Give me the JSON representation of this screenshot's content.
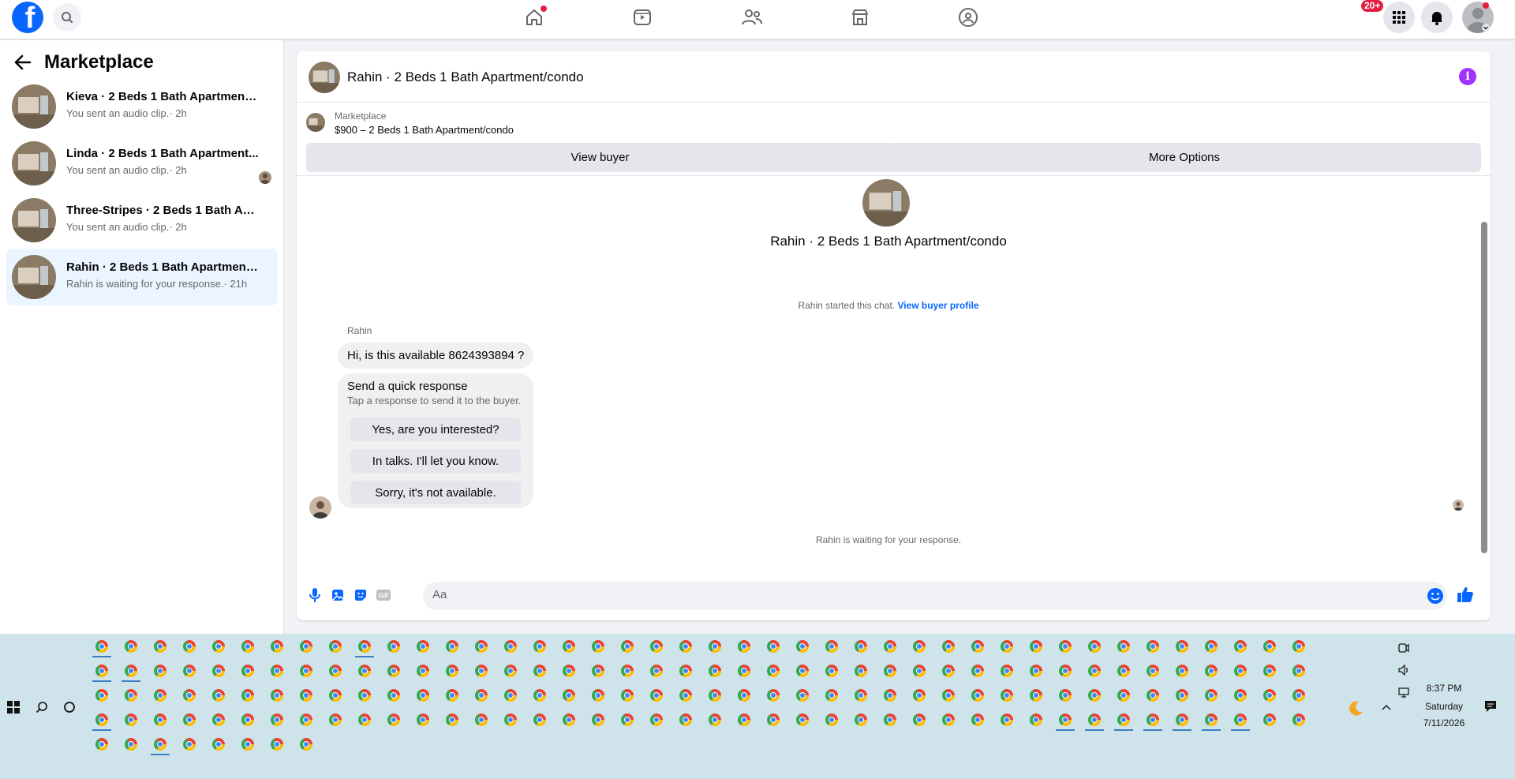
{
  "topnav": {
    "logo": "f",
    "notifications_badge": "20+"
  },
  "sidebar": {
    "title": "Marketplace",
    "conversations": [
      {
        "name": "Kieva · 2 Beds 1 Bath Apartment/c...",
        "sub": "You sent an audio clip.· 2h"
      },
      {
        "name": "Linda · 2 Beds 1 Bath Apartment...",
        "sub": "You sent an audio clip.· 2h"
      },
      {
        "name": "Three-Stripes · 2 Beds 1 Bath Apart...",
        "sub": "You sent an audio clip.· 2h"
      },
      {
        "name": "Rahin · 2 Beds 1 Bath Apartment/c...",
        "sub": "Rahin is waiting for your response.· 21h"
      }
    ]
  },
  "chat": {
    "header_title": "Rahin · 2 Beds 1 Bath Apartment/condo",
    "listing_source": "Marketplace",
    "listing_price": "$900 – 2 Beds 1 Bath Apartment/condo",
    "view_buyer_label": "View buyer",
    "more_options_label": "More Options",
    "center_title": "Rahin · 2 Beds 1 Bath Apartment/condo",
    "started_text": "Rahin started this chat.",
    "view_profile_link": "View buyer profile",
    "sender_name": "Rahin",
    "message": "Hi, is this available 8624393894 ?",
    "quick_title": "Send a quick response",
    "quick_sub": "Tap a response to send it to the buyer.",
    "quick_responses": [
      "Yes, are you interested?",
      "In talks. I'll let you know.",
      "Sorry, it's not available."
    ],
    "waiting_text": "Rahin is waiting for your response.",
    "composer_placeholder": "Aa"
  },
  "taskbar": {
    "time": "8:37 PM",
    "day": "Saturday",
    "date": "7/11/2026"
  },
  "colors": {
    "brand_blue": "#0866ff",
    "active_bg": "#ebf5ff",
    "info_purple": "#a033ff",
    "taskbar_bg": "#cfe3ea"
  }
}
